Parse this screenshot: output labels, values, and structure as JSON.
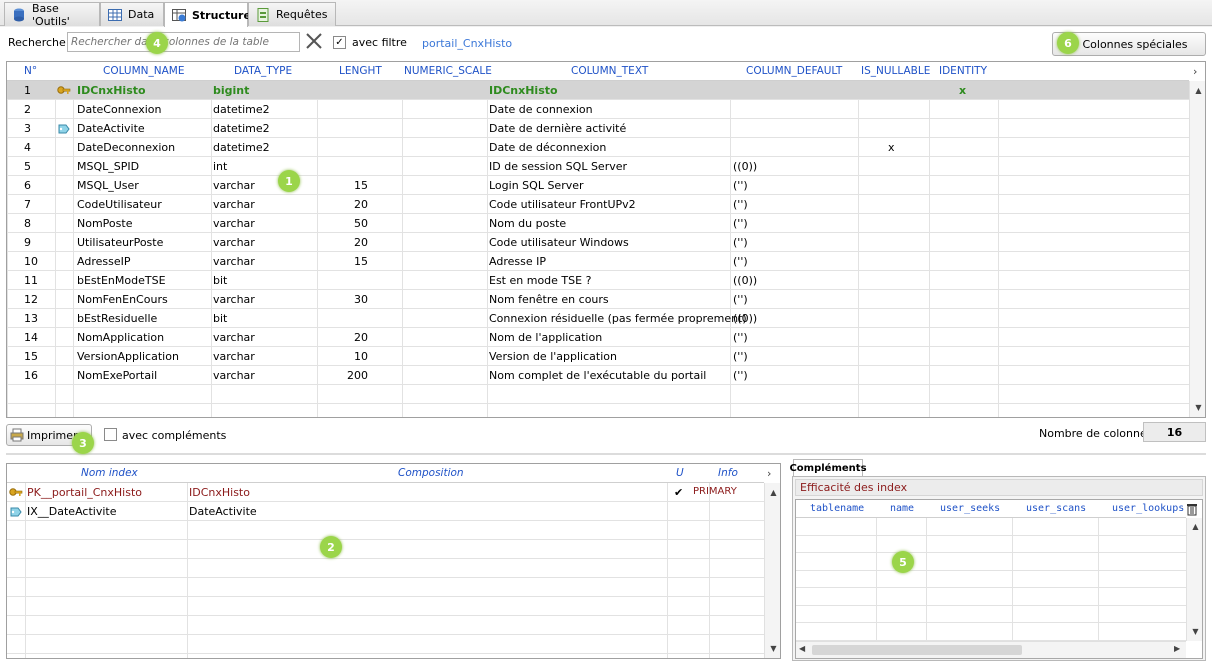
{
  "tabs": [
    {
      "label": "Base 'Outils'",
      "icon": "database-icon"
    },
    {
      "label": "Data",
      "icon": "table-grid-icon"
    },
    {
      "label": "Structure",
      "icon": "structure-icon"
    },
    {
      "label": "Requêtes",
      "icon": "query-icon"
    }
  ],
  "search": {
    "label": "Recherche",
    "placeholder": "Rechercher dans colonnes de la table",
    "filter_label": "avec filtre",
    "table_name": "portail_CnxHisto"
  },
  "special_columns_button": "Colonnes spéciales",
  "bullets": [
    "1",
    "2",
    "3",
    "4",
    "5",
    "6"
  ],
  "columns_grid": {
    "headers": [
      "N°",
      "COLUMN_NAME",
      "DATA_TYPE",
      "LENGHT",
      "NUMERIC_SCALE",
      "COLUMN_TEXT",
      "COLUMN_DEFAULT",
      "IS_NULLABLE",
      "IDENTITY"
    ],
    "rows": [
      {
        "n": "1",
        "name": "IDCnxHisto",
        "type": "bigint",
        "len": "",
        "scale": "",
        "text": "IDCnxHisto",
        "def": "",
        "nullable": "",
        "identity": "x",
        "icon": "key-icon"
      },
      {
        "n": "2",
        "name": "DateConnexion",
        "type": "datetime2",
        "len": "",
        "scale": "",
        "text": "Date de connexion",
        "def": "",
        "nullable": "",
        "identity": "",
        "icon": ""
      },
      {
        "n": "3",
        "name": "DateActivite",
        "type": "datetime2",
        "len": "",
        "scale": "",
        "text": "Date de dernière activité",
        "def": "",
        "nullable": "",
        "identity": "",
        "icon": "index-icon"
      },
      {
        "n": "4",
        "name": "DateDeconnexion",
        "type": "datetime2",
        "len": "",
        "scale": "",
        "text": "Date de déconnexion",
        "def": "",
        "nullable": "x",
        "identity": "",
        "icon": ""
      },
      {
        "n": "5",
        "name": "MSQL_SPID",
        "type": "int",
        "len": "",
        "scale": "",
        "text": "ID de session SQL Server",
        "def": "((0))",
        "nullable": "",
        "identity": "",
        "icon": ""
      },
      {
        "n": "6",
        "name": "MSQL_User",
        "type": "varchar",
        "len": "15",
        "scale": "",
        "text": "Login SQL Server",
        "def": "('')",
        "nullable": "",
        "identity": "",
        "icon": ""
      },
      {
        "n": "7",
        "name": "CodeUtilisateur",
        "type": "varchar",
        "len": "20",
        "scale": "",
        "text": "Code utilisateur FrontUPv2",
        "def": "('')",
        "nullable": "",
        "identity": "",
        "icon": ""
      },
      {
        "n": "8",
        "name": "NomPoste",
        "type": "varchar",
        "len": "50",
        "scale": "",
        "text": "Nom du poste",
        "def": "('')",
        "nullable": "",
        "identity": "",
        "icon": ""
      },
      {
        "n": "9",
        "name": "UtilisateurPoste",
        "type": "varchar",
        "len": "20",
        "scale": "",
        "text": "Code utilisateur Windows",
        "def": "('')",
        "nullable": "",
        "identity": "",
        "icon": ""
      },
      {
        "n": "10",
        "name": "AdresseIP",
        "type": "varchar",
        "len": "15",
        "scale": "",
        "text": "Adresse IP",
        "def": "('')",
        "nullable": "",
        "identity": "",
        "icon": ""
      },
      {
        "n": "11",
        "name": "bEstEnModeTSE",
        "type": "bit",
        "len": "",
        "scale": "",
        "text": "Est en mode TSE ?",
        "def": "((0))",
        "nullable": "",
        "identity": "",
        "icon": ""
      },
      {
        "n": "12",
        "name": "NomFenEnCours",
        "type": "varchar",
        "len": "30",
        "scale": "",
        "text": "Nom fenêtre en cours",
        "def": "('')",
        "nullable": "",
        "identity": "",
        "icon": ""
      },
      {
        "n": "13",
        "name": "bEstResiduelle",
        "type": "bit",
        "len": "",
        "scale": "",
        "text": "Connexion résiduelle (pas fermée proprement)",
        "def": "((0))",
        "nullable": "",
        "identity": "",
        "icon": ""
      },
      {
        "n": "14",
        "name": "NomApplication",
        "type": "varchar",
        "len": "20",
        "scale": "",
        "text": "Nom de l'application",
        "def": "('')",
        "nullable": "",
        "identity": "",
        "icon": ""
      },
      {
        "n": "15",
        "name": "VersionApplication",
        "type": "varchar",
        "len": "10",
        "scale": "",
        "text": "Version de l'application",
        "def": "('')",
        "nullable": "",
        "identity": "",
        "icon": ""
      },
      {
        "n": "16",
        "name": "NomExePortail",
        "type": "varchar",
        "len": "200",
        "scale": "",
        "text": "Nom complet de l'exécutable du portail",
        "def": "('')",
        "nullable": "",
        "identity": "",
        "icon": ""
      }
    ]
  },
  "print_button": "Imprimer",
  "with_complements_label": "avec compléments",
  "column_count": {
    "label": "Nombre de colonnes",
    "value": "16"
  },
  "index_grid": {
    "headers": [
      "Nom index",
      "Composition",
      "U",
      "Info"
    ],
    "rows": [
      {
        "name": "PK__portail_CnxHisto",
        "composition": "IDCnxHisto",
        "unique": "✔",
        "info": "PRIMARY",
        "icon": "key-icon"
      },
      {
        "name": "IX__DateActivite",
        "composition": "DateActivite",
        "unique": "",
        "info": "",
        "icon": "index-icon"
      }
    ]
  },
  "complements": {
    "tab_label": "Compléments",
    "section_title": "Efficacité des index",
    "headers": [
      "tablename",
      "name",
      "user_seeks",
      "user_scans",
      "user_lookups"
    ]
  },
  "colors": {
    "accent_blue": "#1f52c7",
    "green": "#2e8b1e",
    "dark_red": "#8b1a1a",
    "bullet": "#9bd54a",
    "selected_row": "#d4d4d4"
  }
}
